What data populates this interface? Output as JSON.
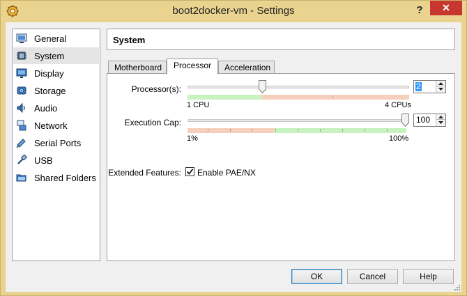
{
  "window": {
    "title": "boot2docker-vm - Settings",
    "help_glyph": "?",
    "close_glyph": "✕"
  },
  "nav": {
    "items": [
      {
        "label": "General",
        "icon": "monitor-icon",
        "selected": false
      },
      {
        "label": "System",
        "icon": "chip-icon",
        "selected": true
      },
      {
        "label": "Display",
        "icon": "display-icon",
        "selected": false
      },
      {
        "label": "Storage",
        "icon": "disk-icon",
        "selected": false
      },
      {
        "label": "Audio",
        "icon": "speaker-icon",
        "selected": false
      },
      {
        "label": "Network",
        "icon": "network-icon",
        "selected": false
      },
      {
        "label": "Serial Ports",
        "icon": "serial-port-icon",
        "selected": false
      },
      {
        "label": "USB",
        "icon": "usb-icon",
        "selected": false
      },
      {
        "label": "Shared Folders",
        "icon": "folder-icon",
        "selected": false
      }
    ]
  },
  "header": {
    "title": "System"
  },
  "tabs": [
    {
      "label": "Motherboard",
      "active": false
    },
    {
      "label": "Processor",
      "active": true
    },
    {
      "label": "Acceleration",
      "active": false
    }
  ],
  "processor": {
    "cpus_label": "Processor(s):",
    "cpus_value": "2",
    "cpus_min_label": "1 CPU",
    "cpus_max_label": "4 CPUs",
    "cpus_fraction": 0.333,
    "cap_label": "Execution Cap:",
    "cap_value": "100",
    "cap_min_label": "1%",
    "cap_max_label": "100%",
    "cap_fraction": 1.0,
    "extended_label": "Extended Features:",
    "pae_label": "Enable PAE/NX",
    "pae_checked": true
  },
  "buttons": {
    "ok": "OK",
    "cancel": "Cancel",
    "help": "Help"
  },
  "colors": {
    "good_range": "#c9f2c1",
    "warn_range": "#f7cfbd",
    "selection": "#3399ff",
    "title_bar": "#e9d38f",
    "close_button": "#c7372f"
  }
}
